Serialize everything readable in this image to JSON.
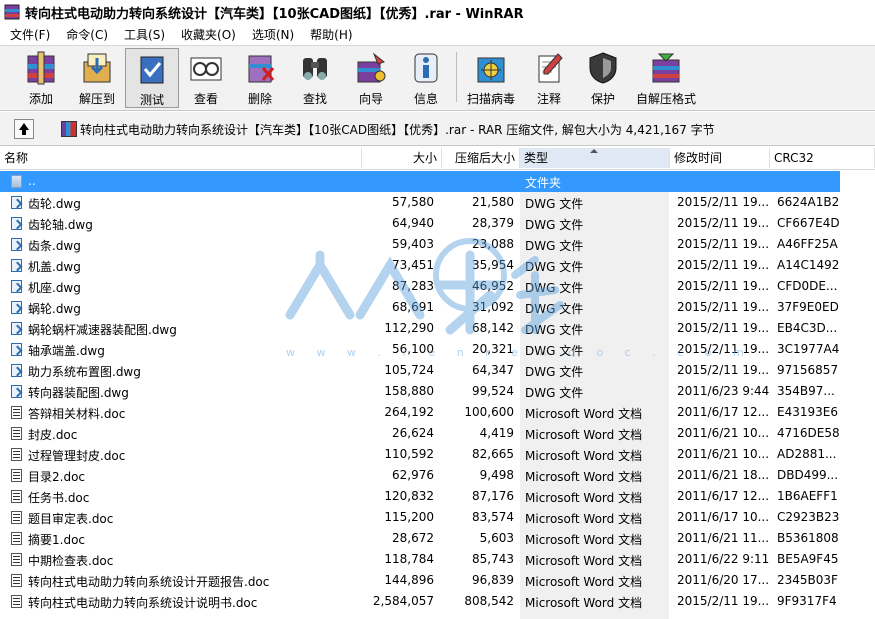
{
  "window": {
    "title": "转向柱式电动助力转向系统设计【汽车类】【10张CAD图纸】【优秀】.rar - WinRAR"
  },
  "menu": [
    "文件(F)",
    "命令(C)",
    "工具(S)",
    "收藏夹(O)",
    "选项(N)",
    "帮助(H)"
  ],
  "toolbar": [
    {
      "label": "添加",
      "icon": "add-archive-icon"
    },
    {
      "label": "解压到",
      "icon": "extract-to-icon"
    },
    {
      "label": "测试",
      "icon": "test-icon"
    },
    {
      "label": "查看",
      "icon": "view-icon"
    },
    {
      "label": "删除",
      "icon": "delete-icon"
    },
    {
      "label": "查找",
      "icon": "find-icon"
    },
    {
      "label": "向导",
      "icon": "wizard-icon"
    },
    {
      "label": "信息",
      "icon": "info-icon"
    },
    {
      "label": "扫描病毒",
      "icon": "virus-scan-icon"
    },
    {
      "label": "注释",
      "icon": "comment-icon"
    },
    {
      "label": "保护",
      "icon": "protect-icon"
    },
    {
      "label": "自解压格式",
      "icon": "sfx-icon"
    }
  ],
  "address": {
    "text": "转向柱式电动助力转向系统设计【汽车类】【10张CAD图纸】【优秀】.rar - RAR 压缩文件, 解包大小为 4,421,167 字节"
  },
  "columns": {
    "name": "名称",
    "size": "大小",
    "packed": "压缩后大小",
    "type": "类型",
    "modified": "修改时间",
    "crc": "CRC32"
  },
  "watermark": {
    "text": "人人文库",
    "url": "w w w . r e n r e n d o c . c o m"
  },
  "files": [
    {
      "name": "..",
      "size": "",
      "packed": "",
      "type": "文件夹",
      "modified": "",
      "crc": "",
      "kind": "up"
    },
    {
      "name": "齿轮.dwg",
      "size": "57,580",
      "packed": "21,580",
      "type": "DWG 文件",
      "modified": "2015/2/11 19...",
      "crc": "6624A1B2",
      "kind": "dwg"
    },
    {
      "name": "齿轮轴.dwg",
      "size": "64,940",
      "packed": "28,379",
      "type": "DWG 文件",
      "modified": "2015/2/11 19...",
      "crc": "CF667E4D",
      "kind": "dwg"
    },
    {
      "name": "齿条.dwg",
      "size": "59,403",
      "packed": "23,088",
      "type": "DWG 文件",
      "modified": "2015/2/11 19...",
      "crc": "A46FF25A",
      "kind": "dwg"
    },
    {
      "name": "机盖.dwg",
      "size": "73,451",
      "packed": "35,954",
      "type": "DWG 文件",
      "modified": "2015/2/11 19...",
      "crc": "A14C1492",
      "kind": "dwg"
    },
    {
      "name": "机座.dwg",
      "size": "87,283",
      "packed": "46,952",
      "type": "DWG 文件",
      "modified": "2015/2/11 19...",
      "crc": "CFD0DE...",
      "kind": "dwg"
    },
    {
      "name": "蜗轮.dwg",
      "size": "68,691",
      "packed": "31,092",
      "type": "DWG 文件",
      "modified": "2015/2/11 19...",
      "crc": "37F9E0ED",
      "kind": "dwg"
    },
    {
      "name": "蜗轮蜗杆减速器装配图.dwg",
      "size": "112,290",
      "packed": "68,142",
      "type": "DWG 文件",
      "modified": "2015/2/11 19...",
      "crc": "EB4C3D...",
      "kind": "dwg"
    },
    {
      "name": "轴承端盖.dwg",
      "size": "56,100",
      "packed": "20,321",
      "type": "DWG 文件",
      "modified": "2015/2/11 19...",
      "crc": "3C1977A4",
      "kind": "dwg"
    },
    {
      "name": "助力系统布置图.dwg",
      "size": "105,724",
      "packed": "64,347",
      "type": "DWG 文件",
      "modified": "2015/2/11 19...",
      "crc": "97156857",
      "kind": "dwg"
    },
    {
      "name": "转向器装配图.dwg",
      "size": "158,880",
      "packed": "99,524",
      "type": "DWG 文件",
      "modified": "2011/6/23 9:44",
      "crc": "354B97...",
      "kind": "dwg"
    },
    {
      "name": "答辩相关材料.doc",
      "size": "264,192",
      "packed": "100,600",
      "type": "Microsoft Word 文档",
      "modified": "2011/6/17 12...",
      "crc": "E43193E6",
      "kind": "doc"
    },
    {
      "name": "封皮.doc",
      "size": "26,624",
      "packed": "4,419",
      "type": "Microsoft Word 文档",
      "modified": "2011/6/21 10...",
      "crc": "4716DE58",
      "kind": "doc"
    },
    {
      "name": "过程管理封皮.doc",
      "size": "110,592",
      "packed": "82,665",
      "type": "Microsoft Word 文档",
      "modified": "2011/6/21 10...",
      "crc": "AD2881...",
      "kind": "doc"
    },
    {
      "name": "目录2.doc",
      "size": "62,976",
      "packed": "9,498",
      "type": "Microsoft Word 文档",
      "modified": "2011/6/21 18...",
      "crc": "DBD499...",
      "kind": "doc"
    },
    {
      "name": "任务书.doc",
      "size": "120,832",
      "packed": "87,176",
      "type": "Microsoft Word 文档",
      "modified": "2011/6/17 12...",
      "crc": "1B6AEFF1",
      "kind": "doc"
    },
    {
      "name": "题目审定表.doc",
      "size": "115,200",
      "packed": "83,574",
      "type": "Microsoft Word 文档",
      "modified": "2011/6/17 10...",
      "crc": "C2923B23",
      "kind": "doc"
    },
    {
      "name": "摘要1.doc",
      "size": "28,672",
      "packed": "5,603",
      "type": "Microsoft Word 文档",
      "modified": "2011/6/21 11...",
      "crc": "B5361808",
      "kind": "doc"
    },
    {
      "name": "中期检查表.doc",
      "size": "118,784",
      "packed": "85,743",
      "type": "Microsoft Word 文档",
      "modified": "2011/6/22 9:11",
      "crc": "BE5A9F45",
      "kind": "doc"
    },
    {
      "name": "转向柱式电动助力转向系统设计开题报告.doc",
      "size": "144,896",
      "packed": "96,839",
      "type": "Microsoft Word 文档",
      "modified": "2011/6/20 17...",
      "crc": "2345B03F",
      "kind": "doc"
    },
    {
      "name": "转向柱式电动助力转向系统设计说明书.doc",
      "size": "2,584,057",
      "packed": "808,542",
      "type": "Microsoft Word 文档",
      "modified": "2015/2/11 19...",
      "crc": "9F9317F4",
      "kind": "doc"
    }
  ]
}
